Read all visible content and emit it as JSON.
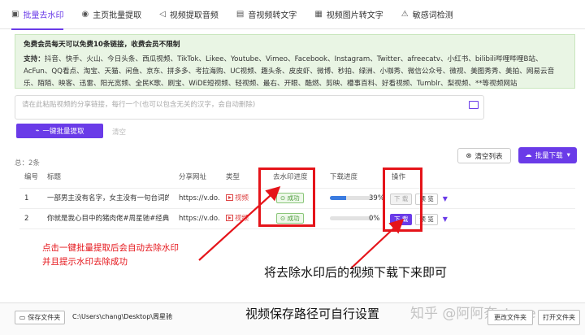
{
  "tabs": [
    {
      "icon": "home-icon",
      "glyph": "▣",
      "label": "批量去水印"
    },
    {
      "icon": "record-icon",
      "glyph": "◉",
      "label": "主页批量提取"
    },
    {
      "icon": "audio-icon",
      "glyph": "◁",
      "label": "视频提取音频"
    },
    {
      "icon": "text-icon",
      "glyph": "▤",
      "label": "音视频转文字"
    },
    {
      "icon": "image-icon",
      "glyph": "▦",
      "label": "视频图片转文字"
    },
    {
      "icon": "warning-icon",
      "glyph": "⚠",
      "label": "敏感词检测"
    }
  ],
  "notice": {
    "headline": "免费会员每天可以免费10条链接，收费会员不限制",
    "support_label": "支持：",
    "platforms": "抖音、快手、火山、今日头条、西瓜视频、TikTok、Likee、Youtube、Vimeo、Facebook、Instagram、Twitter、afreecatv、小红书、bilibili哔哩哔哩B站、AcFun、QQ看点、淘宝、天猫、闲鱼、京东、拼多多、考拉海购、UC视频、趣头条、皮皮虾、微博、秒拍、绿洲、小咖秀、微信公众号、微视、美图秀秀、美拍、网易云音乐、陌陌、映客、迅雷、阳光宽频、全民K歌、刷宝、WiDE短视频、轻视频、最右、开眼、酷燃、剪映、槽事百科、好看视频、Tumblr、梨视频、**等视频网站"
  },
  "input": {
    "placeholder": "请在此粘贴视频的分享链接，每行一个(也可以包含无关的汉字，会自动删除)"
  },
  "buttons": {
    "extract": "一键批量提取",
    "clear": "清空",
    "clear_list": "清空列表",
    "batch_download": "批量下载"
  },
  "total": "总：2条",
  "table": {
    "headers": [
      "编号",
      "标题",
      "分享网址",
      "类型",
      "去水印进度",
      "下载进度",
      "操作"
    ],
    "rows": [
      {
        "no": "1",
        "title": "一部男主没有名字，女主没有一句台词的...",
        "url": "https://v.do...",
        "type": "视频",
        "status": "成功",
        "progress": 0.39,
        "pct": "39%",
        "action": "下 载",
        "preview": "预 览",
        "active": false
      },
      {
        "no": "2",
        "title": "你就是我心目中的猪肉佬#周星驰#经典...",
        "url": "https://v.do...",
        "type": "视频",
        "status": "成功",
        "progress": 0,
        "pct": "0%",
        "action": "下 载",
        "preview": "预 览",
        "active": true
      }
    ]
  },
  "annotations": {
    "left_1": "点击一键批量提取后会自动去除水印",
    "left_2": "并且提示水印去除成功",
    "download": "将去除水印后的视频下载下来即可",
    "path": "视频保存路径可自行设置"
  },
  "bottom": {
    "save_folder": "保存文件夹",
    "path": "C:\\Users\\chang\\Desktop\\周星驰",
    "change_folder": "更改文件夹",
    "open_folder": "打开文件夹"
  },
  "watermark": "知乎 @阿阿奈stone",
  "colors": {
    "accent": "#6a3be8",
    "annotation_red": "#e5141a",
    "success": "#4a9a3a",
    "notice_bg": "#e9f5e4"
  }
}
